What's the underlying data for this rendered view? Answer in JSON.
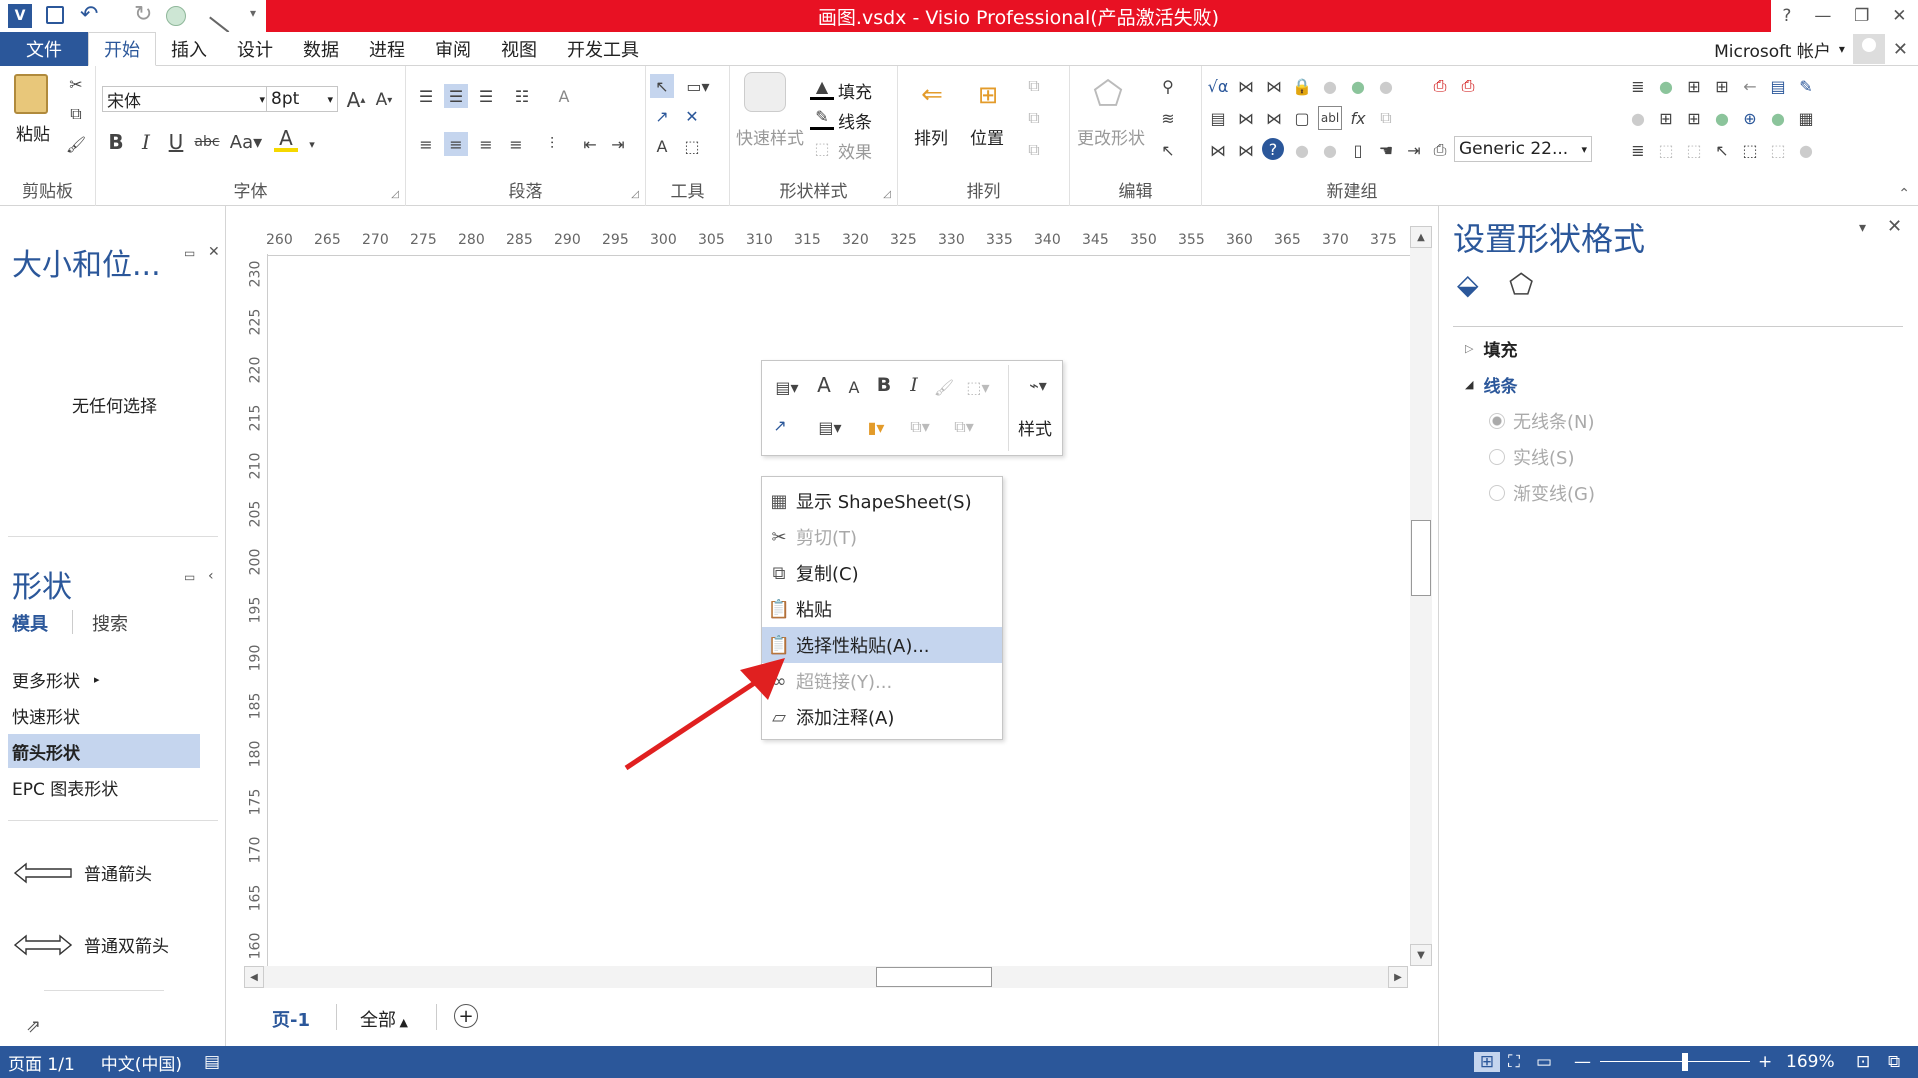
{
  "window": {
    "title": "画图.vsdx - Visio Professional(产品激活失败)",
    "help": "?",
    "minimize": "—",
    "restore": "❐",
    "close": "✕"
  },
  "tabs": [
    "文件",
    "开始",
    "插入",
    "设计",
    "数据",
    "进程",
    "审阅",
    "视图",
    "开发工具"
  ],
  "active_tab": "开始",
  "account": "Microsoft 帐户",
  "ribbon": {
    "clipboard": {
      "paste": "粘贴",
      "label": "剪贴板"
    },
    "font": {
      "family": "宋体",
      "size": "8pt",
      "label": "字体"
    },
    "paragraph": {
      "label": "段落"
    },
    "tools": {
      "label": "工具"
    },
    "shape_styles": {
      "quick": "快速样式",
      "fill": "填充",
      "line": "线条",
      "effect": "效果",
      "label": "形状样式"
    },
    "arrange": {
      "arrange": "排列",
      "position": "位置",
      "label": "排列"
    },
    "edit": {
      "change_shape": "更改形状",
      "label": "编辑"
    },
    "new_group": {
      "theme": "Generic 22...",
      "label": "新建组"
    }
  },
  "size_panel": {
    "title": "大小和位...",
    "empty": "无任何选择"
  },
  "shapes_panel": {
    "title": "形状",
    "tab_stencil": "模具",
    "tab_search": "搜索",
    "items": [
      "更多形状",
      "快速形状",
      "箭头形状",
      "EPC 图表形状"
    ],
    "selected": "箭头形状",
    "masters": [
      "普通箭头",
      "普通双箭头"
    ]
  },
  "ruler": {
    "h": [
      "260",
      "265",
      "270",
      "275",
      "280",
      "285",
      "290",
      "295",
      "300",
      "305",
      "310",
      "315",
      "320",
      "325",
      "330",
      "335",
      "340",
      "345",
      "350",
      "355",
      "360",
      "365",
      "370",
      "375"
    ],
    "v": [
      "230",
      "225",
      "220",
      "215",
      "210",
      "205",
      "200",
      "195",
      "190",
      "185",
      "180",
      "175",
      "170",
      "165",
      "160"
    ]
  },
  "mini_toolbar": {
    "style": "样式"
  },
  "context_menu": [
    {
      "label": "显示 ShapeSheet(S)",
      "icon": "shapesheet-icon",
      "disabled": false,
      "highlight": false
    },
    {
      "label": "剪切(T)",
      "icon": "scissors-icon",
      "disabled": true,
      "highlight": false
    },
    {
      "label": "复制(C)",
      "icon": "copy-icon",
      "disabled": false,
      "highlight": false
    },
    {
      "label": "粘贴",
      "icon": "paste-icon",
      "disabled": false,
      "highlight": false
    },
    {
      "label": "选择性粘贴(A)...",
      "icon": "paste-special-icon",
      "disabled": false,
      "highlight": true
    },
    {
      "label": "超链接(Y)...",
      "icon": "hyperlink-icon",
      "disabled": true,
      "highlight": false
    },
    {
      "label": "添加注释(A)",
      "icon": "comment-icon",
      "disabled": false,
      "highlight": false
    }
  ],
  "page_tabs": {
    "current": "页-1",
    "all": "全部"
  },
  "format_panel": {
    "title": "设置形状格式",
    "fill": "填充",
    "line": "线条",
    "options": [
      "无线条(N)",
      "实线(S)",
      "渐变线(G)"
    ]
  },
  "status": {
    "page": "页面 1/1",
    "lang": "中文(中国)",
    "zoom": "169%"
  },
  "colors": {
    "title_bar": "#e81123",
    "accent": "#2b579a",
    "highlight": "#c5d5ee",
    "arrow": "#e02020"
  }
}
